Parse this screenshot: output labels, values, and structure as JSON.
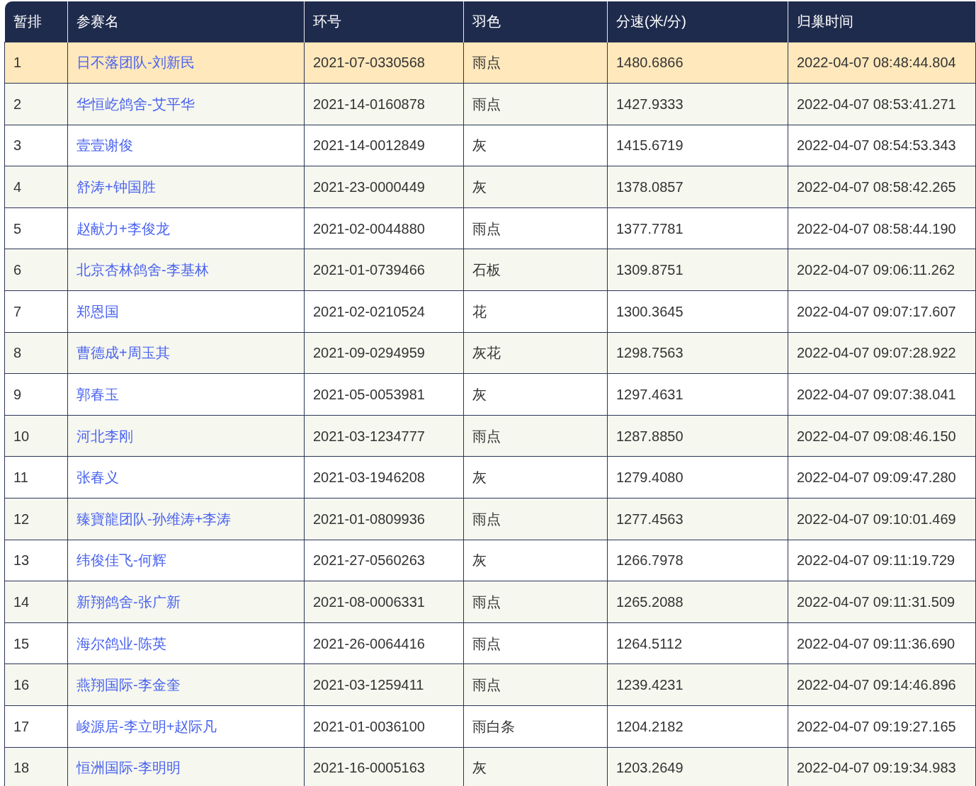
{
  "table": {
    "columns": [
      "暂排",
      "参赛名",
      "环号",
      "羽色",
      "分速(米/分)",
      "归巢时间"
    ],
    "rows": [
      {
        "rank": "1",
        "name": "日不落团队-刘新民",
        "ring": "2021-07-0330568",
        "plumage": "雨点",
        "speed": "1480.6866",
        "time": "2022-04-07 08:48:44.804",
        "selected": true
      },
      {
        "rank": "2",
        "name": "华恒屹鸽舍-艾平华",
        "ring": "2021-14-0160878",
        "plumage": "雨点",
        "speed": "1427.9333",
        "time": "2022-04-07 08:53:41.271",
        "selected": false
      },
      {
        "rank": "3",
        "name": "壹壹谢俊",
        "ring": "2021-14-0012849",
        "plumage": "灰",
        "speed": "1415.6719",
        "time": "2022-04-07 08:54:53.343",
        "selected": false
      },
      {
        "rank": "4",
        "name": "舒涛+钟国胜",
        "ring": "2021-23-0000449",
        "plumage": "灰",
        "speed": "1378.0857",
        "time": "2022-04-07 08:58:42.265",
        "selected": false
      },
      {
        "rank": "5",
        "name": "赵献力+李俊龙",
        "ring": "2021-02-0044880",
        "plumage": "雨点",
        "speed": "1377.7781",
        "time": "2022-04-07 08:58:44.190",
        "selected": false
      },
      {
        "rank": "6",
        "name": "北京杏林鸽舍-李基林",
        "ring": "2021-01-0739466",
        "plumage": "石板",
        "speed": "1309.8751",
        "time": "2022-04-07 09:06:11.262",
        "selected": false
      },
      {
        "rank": "7",
        "name": "郑恩国",
        "ring": "2021-02-0210524",
        "plumage": "花",
        "speed": "1300.3645",
        "time": "2022-04-07 09:07:17.607",
        "selected": false
      },
      {
        "rank": "8",
        "name": "曹德成+周玉其",
        "ring": "2021-09-0294959",
        "plumage": "灰花",
        "speed": "1298.7563",
        "time": "2022-04-07 09:07:28.922",
        "selected": false
      },
      {
        "rank": "9",
        "name": "郭春玉",
        "ring": "2021-05-0053981",
        "plumage": "灰",
        "speed": "1297.4631",
        "time": "2022-04-07 09:07:38.041",
        "selected": false
      },
      {
        "rank": "10",
        "name": "河北李刚",
        "ring": "2021-03-1234777",
        "plumage": "雨点",
        "speed": "1287.8850",
        "time": "2022-04-07 09:08:46.150",
        "selected": false
      },
      {
        "rank": "11",
        "name": "张春义",
        "ring": "2021-03-1946208",
        "plumage": "灰",
        "speed": "1279.4080",
        "time": "2022-04-07 09:09:47.280",
        "selected": false
      },
      {
        "rank": "12",
        "name": "臻寶龍团队-孙维涛+李涛",
        "ring": "2021-01-0809936",
        "plumage": "雨点",
        "speed": "1277.4563",
        "time": "2022-04-07 09:10:01.469",
        "selected": false
      },
      {
        "rank": "13",
        "name": "纬俊佳飞-何辉",
        "ring": "2021-27-0560263",
        "plumage": "灰",
        "speed": "1266.7978",
        "time": "2022-04-07 09:11:19.729",
        "selected": false
      },
      {
        "rank": "14",
        "name": "新翔鸽舍-张广新",
        "ring": "2021-08-0006331",
        "plumage": "雨点",
        "speed": "1265.2088",
        "time": "2022-04-07 09:11:31.509",
        "selected": false
      },
      {
        "rank": "15",
        "name": "海尔鸽业-陈英",
        "ring": "2021-26-0064416",
        "plumage": "雨点",
        "speed": "1264.5112",
        "time": "2022-04-07 09:11:36.690",
        "selected": false
      },
      {
        "rank": "16",
        "name": "燕翔国际-李金奎",
        "ring": "2021-03-1259411",
        "plumage": "雨点",
        "speed": "1239.4231",
        "time": "2022-04-07 09:14:46.896",
        "selected": false
      },
      {
        "rank": "17",
        "name": "峻源居-李立明+赵际凡",
        "ring": "2021-01-0036100",
        "plumage": "雨白条",
        "speed": "1204.2182",
        "time": "2022-04-07 09:19:27.165",
        "selected": false
      },
      {
        "rank": "18",
        "name": "恒洲国际-李明明",
        "ring": "2021-16-0005163",
        "plumage": "灰",
        "speed": "1203.2649",
        "time": "2022-04-07 09:19:34.983",
        "selected": false
      }
    ]
  }
}
